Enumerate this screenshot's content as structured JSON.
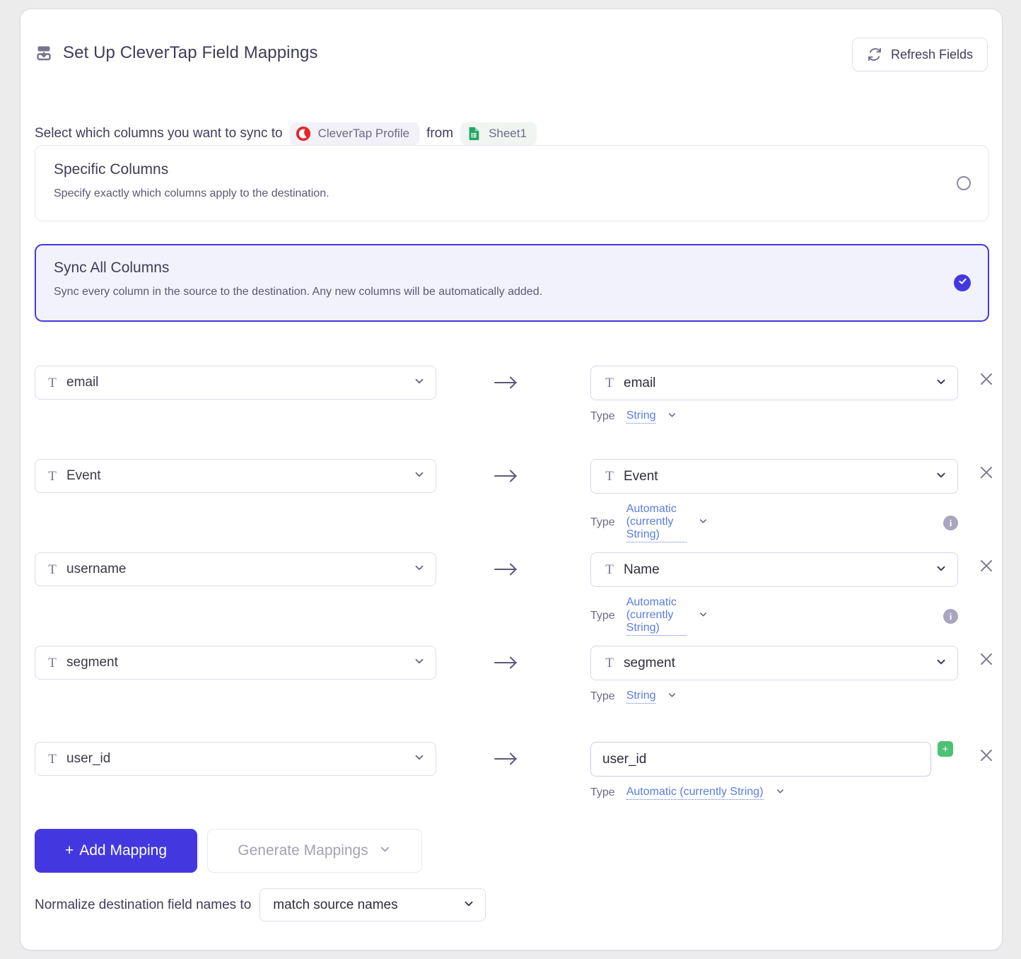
{
  "header": {
    "icon": "import-merge-icon",
    "title": "Set Up CleverTap Field Mappings",
    "refresh_label": "Refresh Fields",
    "refresh_icon": "refresh-icon"
  },
  "subtitle": {
    "lead": "Select which columns you want to sync to",
    "destination_pill": {
      "label": "CleverTap Profile",
      "icon": "clevertap-logo-icon"
    },
    "connector": "from",
    "source_pill": {
      "label": "Sheet1",
      "icon": "google-sheets-icon"
    }
  },
  "options": [
    {
      "title": "Specific Columns",
      "description": "Specify exactly which columns apply to the destination.",
      "selected": false
    },
    {
      "title": "Sync All Columns",
      "description": "Sync every column in the source to the destination. Any new columns will be automatically added.",
      "selected": true
    }
  ],
  "mappings": [
    {
      "source": {
        "value": "email",
        "type_icon": "string-type-icon"
      },
      "arrow": "arrow-right-icon",
      "destination": {
        "value": "email",
        "type_icon": "string-type-icon",
        "kind": "select",
        "type_label": "Type",
        "type_value": "String",
        "has_info": false,
        "has_plus": false
      }
    },
    {
      "source": {
        "value": "Event",
        "type_icon": "string-type-icon"
      },
      "arrow": "arrow-right-icon",
      "destination": {
        "value": "Event",
        "type_icon": "string-type-icon",
        "kind": "select",
        "type_label": "Type",
        "type_value": "Automatic (currently String)",
        "has_info": true,
        "has_plus": false
      }
    },
    {
      "source": {
        "value": "username",
        "type_icon": "string-type-icon"
      },
      "arrow": "arrow-right-icon",
      "destination": {
        "value": "Name",
        "type_icon": "string-type-icon",
        "kind": "select",
        "type_label": "Type",
        "type_value": "Automatic (currently String)",
        "has_info": true,
        "has_plus": false
      }
    },
    {
      "source": {
        "value": "segment",
        "type_icon": "string-type-icon"
      },
      "arrow": "arrow-right-icon",
      "destination": {
        "value": "segment",
        "type_icon": "string-type-icon",
        "kind": "select",
        "type_label": "Type",
        "type_value": "String",
        "has_info": false,
        "has_plus": false
      }
    },
    {
      "source": {
        "value": "user_id",
        "type_icon": "string-type-icon"
      },
      "arrow": "arrow-right-icon",
      "destination": {
        "value": "user_id",
        "type_icon": null,
        "kind": "text",
        "type_label": "Type",
        "type_value": "Automatic (currently String)",
        "has_info": false,
        "has_plus": true
      }
    }
  ],
  "footer": {
    "add_mapping_label": "Add Mapping",
    "add_mapping_plus": "+",
    "generate_mappings_label": "Generate Mappings",
    "normalize_label": "Normalize destination field names to",
    "normalize_value": "match source names"
  },
  "colors": {
    "accent": "#4338e0",
    "accent_bg": "#f2f2fd",
    "link": "#5a7ce0",
    "green": "#4cc273",
    "clevertap_red": "#e5262b",
    "sheets_green": "#23a566"
  }
}
